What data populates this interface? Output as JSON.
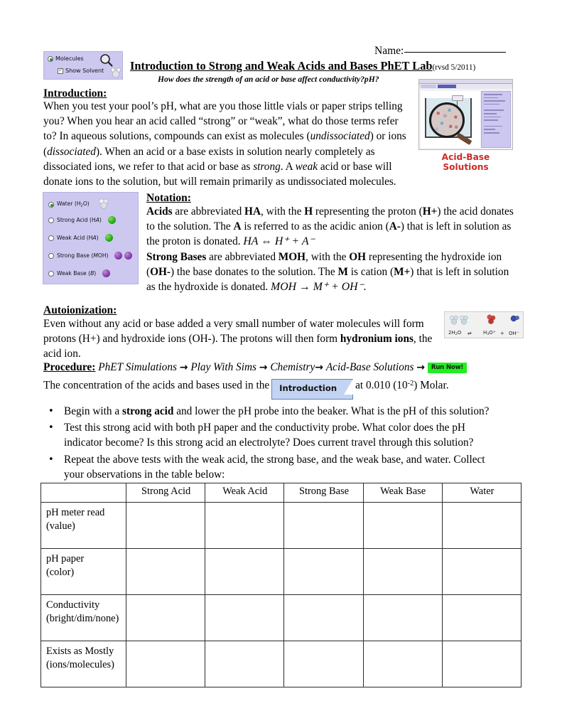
{
  "header": {
    "name_label": "Name:",
    "title": "Introduction to Strong and Weak Acids and Bases PhET Lab",
    "revision": "(rvsd 5/2011)",
    "subtitle": "How does the strength of an acid or base affect conductivity?pH?"
  },
  "molecules_widget": {
    "molecules_label": "Molecules",
    "show_solvent_label": "Show Solvent",
    "magnifier_icon": "magnifier-icon",
    "solvent_icon": "water-molecule-icon"
  },
  "sim_thumbnail": {
    "caption": "Acid-Base Solutions",
    "caption_color": "#cc2b28"
  },
  "introduction": {
    "heading": "Introduction:",
    "p1_a": "When you test your pool’s pH, what are you those little vials or paper strips telling you?  When you hear an acid called “strong” or “weak”, what do those terms refer to?  In aqueous solutions, compounds can exist as molecules (",
    "undissociated": "undissociated",
    "p1_b": ") or ions (",
    "dissociated": "dissociated",
    "p1_c": ").  When an acid or a base exists in solution nearly completely as dissociated ions, we refer to that acid or base as ",
    "strong": "strong",
    "p1_d": ".  A ",
    "weak": "weak",
    "p1_e": " acid or base will donate ions to the solution, but will remain primarily as undissociated molecules."
  },
  "legend_panel": {
    "items": [
      {
        "label_prefix": "Water (H",
        "label_sub": "2",
        "label_suffix": "O)",
        "selected": true,
        "swatch": "white-molecule"
      },
      {
        "label_prefix": "Strong Acid (H",
        "label_ital": "A",
        "label_suffix": ")",
        "selected": false,
        "swatch": "green-molecule"
      },
      {
        "label_prefix": "Weak Acid (H",
        "label_ital": "A",
        "label_suffix": ")",
        "selected": false,
        "swatch": "green-molecule"
      },
      {
        "label_prefix": "Strong Base (",
        "label_ital": "M",
        "label_suffix": "OH)",
        "selected": false,
        "swatch": "purple-molecule"
      },
      {
        "label_prefix": "Weak Base (",
        "label_ital": "B",
        "label_suffix": ")",
        "selected": false,
        "swatch": "purple-molecule"
      }
    ]
  },
  "notation": {
    "heading": "Notation:",
    "acids_bold": "Acids",
    "s1_a": " are abbreviated ",
    "ha_bold": "HA",
    "s1_b": ", with the ",
    "h_bold": "H",
    "s1_c": " representing the proton (",
    "hplus_bold": "H+",
    "s1_d": ") the acid donates to the solution.  The ",
    "a_bold": "A",
    "s1_e": " is referred to as the acidic anion (",
    "aminus_bold": "A-",
    "s1_f": ") that is left in solution as the proton is donated. ",
    "acid_equation": "HA ⇔ H⁺ + A⁻",
    "strong_bases_bold": "Strong Bases",
    "s2_a": " are abbreviated ",
    "moh_bold": "MOH",
    "s2_b": ", with the ",
    "oh_bold": "OH",
    "s2_c": " representing the hydroxide ion (",
    "ohminus_bold": "OH-",
    "s2_d": ") the base donates to the solution.  The ",
    "m_bold": "M",
    "s2_e": " is cation (",
    "mplus_bold": "M+",
    "s2_f": ") that is left in solution as the hydroxide is donated. ",
    "base_equation": "MOH → M⁺ + OH⁻."
  },
  "autoionization": {
    "heading": "Autoionization:",
    "text_a": "Even without any acid or base added a very small number of water molecules will form protons (H+) and hydroxide ions (OH-).  The protons will then form ",
    "hydronium_bold": "hydronium ions",
    "text_b": ", the acid ion.",
    "equation_image_label": "2H2O ⇌ H3O⁺ + OH⁻"
  },
  "procedure": {
    "heading": "Procedure:",
    "step1": "PhET Simulations",
    "step2": "Play With Sims",
    "step3": "Chemistry",
    "step4": "Acid-Base Solutions",
    "arrow": "→",
    "run_now_label": "Run Now!",
    "run_now_color": "#22ee22",
    "concentration_prefix": "The concentration of the acids and bases used in the",
    "introduction_tab_label": "Introduction",
    "concentration_suffix_a": "at 0.010 (10",
    "concentration_exponent": "-2",
    "concentration_suffix_b": ") Molar."
  },
  "bullets": [
    {
      "marker": "•",
      "pre": "Begin with a ",
      "bold": "strong acid",
      "post": " and lower the pH probe into the beaker.  What is the pH of this solution?"
    },
    {
      "marker": "•",
      "pre": "",
      "bold": "",
      "post": "Test this strong acid with both pH paper and the conductivity probe.  What color does the pH indicator become?  Is this strong acid an electrolyte?  Does current travel through this solution?"
    },
    {
      "marker": "•",
      "pre": "",
      "bold": "",
      "post": "Repeat the above tests with the weak acid, the strong base, and the weak base, and water.  Collect your observations in the table below:"
    }
  ],
  "observation_table": {
    "columns": [
      "",
      "Strong Acid",
      "Weak Acid",
      "Strong Base",
      "Weak Base",
      "Water"
    ],
    "rows": [
      {
        "label_line1": "pH meter read",
        "label_line2": "(value)",
        "cells": [
          "",
          "",
          "",
          "",
          ""
        ]
      },
      {
        "label_line1": "pH paper",
        "label_line2": "(color)",
        "cells": [
          "",
          "",
          "",
          "",
          ""
        ]
      },
      {
        "label_line1": "Conductivity",
        "label_line2": "(bright/dim/none)",
        "cells": [
          "",
          "",
          "",
          "",
          ""
        ]
      },
      {
        "label_line1": "Exists as Mostly",
        "label_line2": "(ions/molecules)",
        "cells": [
          "",
          "",
          "",
          "",
          ""
        ]
      }
    ]
  }
}
